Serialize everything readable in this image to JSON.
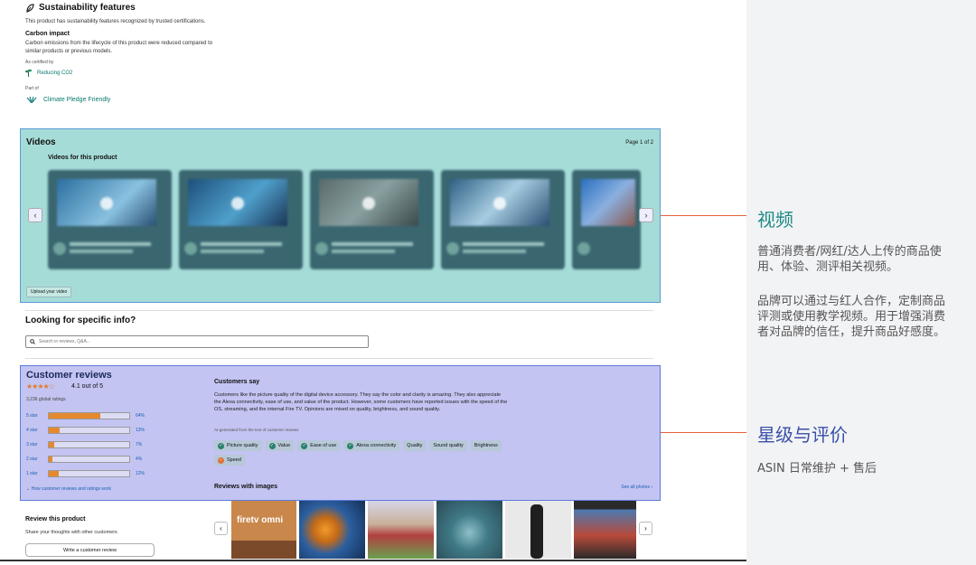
{
  "sustainability": {
    "title": "Sustainability features",
    "description": "This product has sustainability features recognized by trusted certifications.",
    "carbon_title": "Carbon impact",
    "carbon_desc": "Carbon emissions from the lifecycle of this product were reduced compared to similar products or previous models.",
    "certified_by": "As certified by",
    "reducing_link": "Reducing CO2",
    "part_of": "Part of",
    "pledge_link": "Climate Pledge Friendly",
    "icon": "leaf-icon"
  },
  "videos": {
    "title": "Videos",
    "page": "Page 1 of 2",
    "subtitle": "Videos for this product",
    "upload_label": "Upload your video",
    "prev": "‹",
    "next": "›"
  },
  "lookup": {
    "title": "Looking for specific info?",
    "placeholder": "Search in reviews, Q&A..."
  },
  "reviews": {
    "title": "Customer reviews",
    "stars": "★★★★☆",
    "rating": "4.1 out of 5",
    "global": "3,236 global ratings",
    "rows": [
      {
        "label": "5 star",
        "pct": "64%",
        "value": 64
      },
      {
        "label": "4 star",
        "pct": "13%",
        "value": 13
      },
      {
        "label": "3 star",
        "pct": "7%",
        "value": 7
      },
      {
        "label": "2 star",
        "pct": "4%",
        "value": 4
      },
      {
        "label": "1 star",
        "pct": "12%",
        "value": 12
      }
    ],
    "how_link": "How customer reviews and ratings work",
    "customers_say_title": "Customers say",
    "customers_say_text": "Customers like the picture quality of the digital device accessory. They say the color and clarity is amazing. They also appreciate the Alexa connectivity, ease of use, and value of the product. However, some customers have reported issues with the speed of the OS, streaming, and the internal Fire TV. Opinions are mixed on quality, brightness, and sound quality.",
    "ai_note": "AI-generated from the text of customer reviews",
    "chips": [
      {
        "label": "Picture quality",
        "kind": "pos"
      },
      {
        "label": "Value",
        "kind": "pos"
      },
      {
        "label": "Ease of use",
        "kind": "pos"
      },
      {
        "label": "Alexa connectivity",
        "kind": "pos"
      },
      {
        "label": "Quality",
        "kind": "mixed"
      },
      {
        "label": "Sound quality",
        "kind": "mixed"
      },
      {
        "label": "Brightness",
        "kind": "mixed"
      },
      {
        "label": "Speed",
        "kind": "neg"
      }
    ],
    "rwi_title": "Reviews with images",
    "see_all": "See all photos ›"
  },
  "write": {
    "title": "Review this product",
    "share": "Share your thoughts with other customers",
    "button": "Write a customer review"
  },
  "gallery": {
    "img1_text": "firetv omni",
    "prev": "‹",
    "next": "›"
  },
  "annotations": {
    "video_title": "视频",
    "video_p1": "普通消费者/网红/达人上传的商品使用、体验、测评相关视频。",
    "video_p2": "品牌可以通过与红人合作，定制商品评测或使用教学视频。用于增强消费者对品牌的信任，提升商品好感度。",
    "review_title": "星级与评价",
    "review_p1": "ASIN 日常维护 + 售后"
  },
  "colors": {
    "video_highlight": "#a6dcd8",
    "review_highlight": "#c3c4f2",
    "connector": "#e8623a",
    "video_title": "#1d8a86",
    "review_title": "#3a4fa8"
  }
}
